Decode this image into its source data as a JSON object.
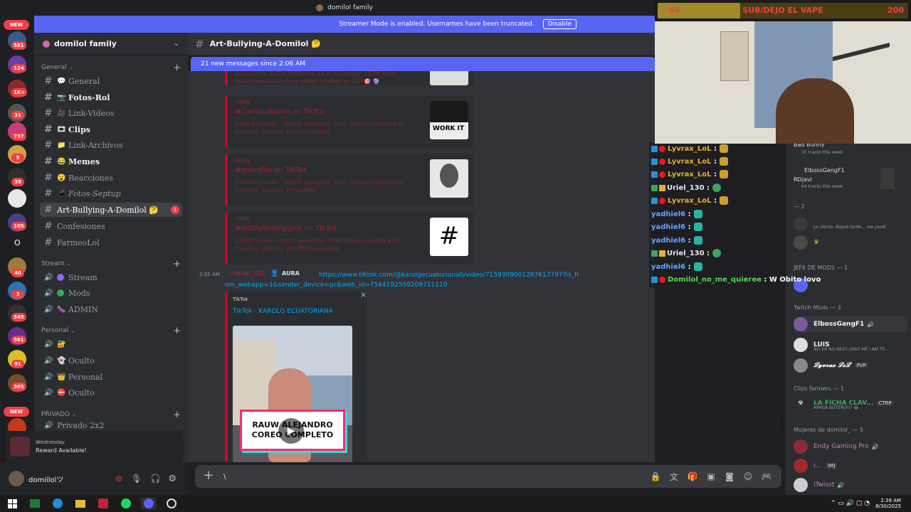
{
  "window": {
    "title": "domilol family"
  },
  "streamer_bar": {
    "text": "Streamer Mode is enabled. Usernames have been truncated.",
    "button": "Disable"
  },
  "server": {
    "name": "domilol family"
  },
  "rail": {
    "new_top": "NEW",
    "new_bottom": "NEW",
    "badges": [
      "581",
      "124",
      "1K+",
      "31",
      "737",
      "5",
      "39",
      "105",
      "40",
      "3",
      "349",
      "581",
      "91",
      "305"
    ],
    "letter": "O"
  },
  "sidebar": {
    "cat_general": "General",
    "cat_stream": "Stream",
    "cat_personal": "Personal",
    "cat_private": "PRIVADO",
    "ch_general": "General",
    "ch_fotos_rol": "Fotos-Rol",
    "ch_link_videos": "Link-Videos",
    "ch_clips": "Clips",
    "ch_link_archivos": "Link-Archivos",
    "ch_memes": "Memes",
    "ch_reacciones": "Reacciones",
    "ch_fotos_septup": "Fotos-Septup",
    "ch_art": "Art-Bullying-A-Domilol 🤔",
    "ch_art_badge": "1",
    "ch_confesiones": "Confesiones",
    "ch_farmeolol": "FarmeoLol",
    "v_stream": "Stream",
    "v_mods": "Mods",
    "v_admin": "ADMIN",
    "v_oculto1": "Oculto",
    "v_personal": "Personal",
    "v_oculto2": "Oculto",
    "v_privado": "Privado 2x2"
  },
  "reward": {
    "title": "Wednesday",
    "text": "Reward Available!"
  },
  "user": {
    "name": "domiilolツ"
  },
  "channel_header": {
    "name": "Art-Bullying-A-Domilol 🤔"
  },
  "new_messages": {
    "text": "21 new messages since 2:06 AM"
  },
  "embeds": [
    {
      "provider": "",
      "title": "",
      "desc": "@ilusion0's TikTok followers, 1836 Following. 187M Likes - Watch awesome short videos created by LiLi 🎯 🔮"
    },
    {
      "provider": "TikTok",
      "title": "#CanYouWorkIt on TikTok",
      "desc": "6900.0m views - Watch awesome short videos created with trending hashtag #CanYouWorkIt"
    },
    {
      "provider": "TikTok",
      "title": "#moodflip on TikTok",
      "desc": "5700.0m views - Watch awesome short videos created with trending hashtag #moodflip"
    },
    {
      "provider": "TikTok",
      "title": "#doitforthebiggirls on TikTok",
      "desc": "1169m views - Watch awesome short videos created with trending hashtag #doitforthebiggirls"
    }
  ],
  "message": {
    "time": "2:32 AM",
    "author": "chaval_LOL",
    "tag": "AURA",
    "link": "https://www.tiktok.com/@karolgecuatoriana0/video/7159309001287617797?is_from_webapp=1&sender_device=pc&web_id=7544192559209711110",
    "embed_provider": "TikTok",
    "embed_title": "TikTok · KAROLG ECUATORIANA",
    "caption": "RAUW ALEJANDRO COREO COMPLETO"
  },
  "composer": {
    "value": "\\"
  },
  "stream_chat": [
    {
      "user": "Lyvrax_LoL",
      "color": "#e3b12f"
    },
    {
      "user": "Lyvrax_LoL",
      "color": "#e3b12f"
    },
    {
      "user": "Lyvrax_LoL",
      "color": "#e3b12f"
    },
    {
      "user": "Uriel_130",
      "color": "#e8e8e8"
    },
    {
      "user": "Lyvrax_LoL",
      "color": "#e3b12f"
    },
    {
      "user": "yadhiel6",
      "color": "#66a3ff"
    },
    {
      "user": "yadhiel6",
      "color": "#66a3ff"
    },
    {
      "user": "yadhiel6",
      "color": "#66a3ff"
    },
    {
      "user": "Uriel_130",
      "color": "#e8e8e8"
    },
    {
      "user": "yadhiel6",
      "color": "#66a3ff"
    },
    {
      "user": "Domilol_no_me_quieree",
      "color": "#4fd84f",
      "msg": "W Obito lovo"
    }
  ],
  "overlay": {
    "left": "66",
    "title": "SUB/DEJO EL VAPE",
    "right": "200"
  },
  "members": {
    "bad_bunny": "Bad Bunny",
    "bad_bunny_sub": "30 tracks this week",
    "elboss_top": "ElbossGangF1",
    "rdjavi": "RDjavi",
    "rdjavi_sub": "64 tracks this week",
    "cat_2": "— 2",
    "late_sub": "Lo siento, llegué tarde... me perdí",
    "cat_jefe": "JEFE DE MODS — 1",
    "cat_twitch": "Twitch Mods — 3",
    "m_elboss": "ElbossGangF1",
    "m_luis": "LUIS",
    "m_luis_sub": "NO EX NO NEXT ONLY ME I AM TE...",
    "m_lyvrax": "𝓛𝔂𝓿𝓻𝓪𝔁 𝓛𝓸𝓛",
    "m_lyvrax_tag": "PVP",
    "cat_clips": "Clips farmers — 1",
    "m_ficha": "LA FICHA CLAV...",
    "m_ficha_tag": "CTRP",
    "m_ficha_sub": "APAGA BOTERO!!! 😂",
    "cat_mujeres": "Mujeres de domilol_ — 5",
    "m_endy": "Endy Gaming Pro",
    "m_i": "i...",
    "m_i_tag": "IMJ",
    "m_itwisst": "iTwisst"
  },
  "taskbar": {
    "time": "2:39 AM",
    "date": "8/30/2025"
  },
  "colors": {
    "accent": "#5865f2",
    "unread": "#f23f43",
    "tiktok": "#d6002a"
  }
}
